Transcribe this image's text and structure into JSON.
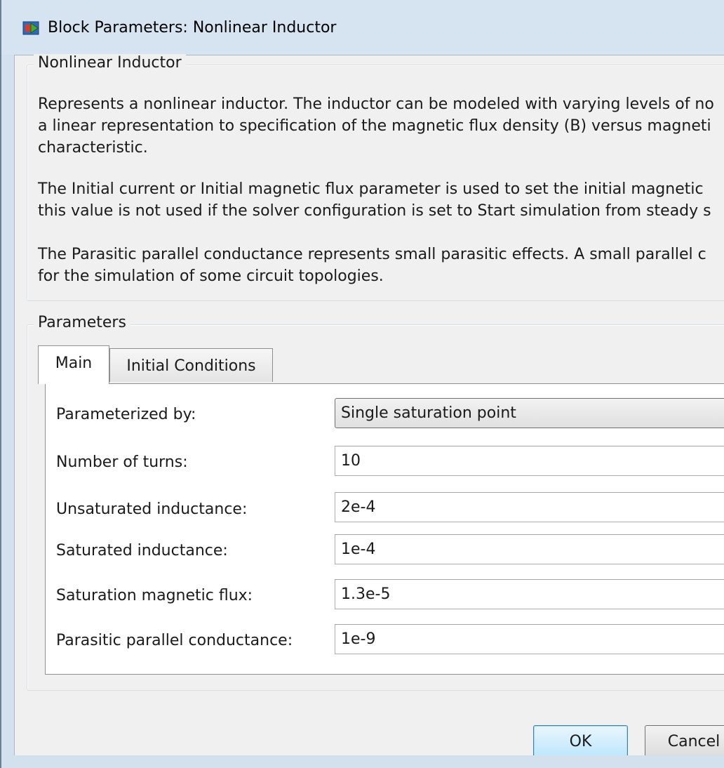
{
  "window": {
    "title": "Block Parameters: Nonlinear Inductor"
  },
  "description_group": {
    "title": "Nonlinear Inductor",
    "paragraphs": [
      [
        "Represents a nonlinear inductor. The inductor can be modeled with varying levels of no",
        "a linear representation to specification of the magnetic flux density (B) versus magneti",
        "characteristic."
      ],
      [
        "The Initial current or Initial magnetic flux parameter is used to set the initial magnetic",
        "this value is not used if the solver configuration is set to Start simulation from steady s"
      ],
      [
        "The Parasitic parallel conductance represents small parasitic effects. A small parallel c",
        "for the simulation of some circuit topologies."
      ]
    ]
  },
  "parameters_group": {
    "title": "Parameters",
    "tabs": [
      {
        "label": "Main",
        "selected": true
      },
      {
        "label": "Initial Conditions",
        "selected": false
      }
    ],
    "fields": [
      {
        "label": "Parameterized by:",
        "value": "Single saturation point",
        "type": "select"
      },
      {
        "label": "Number of turns:",
        "value": "10",
        "type": "text"
      },
      {
        "label": "Unsaturated inductance:",
        "value": "2e-4",
        "type": "text"
      },
      {
        "label": "Saturated inductance:",
        "value": "1e-4",
        "type": "text"
      },
      {
        "label": "Saturation magnetic flux:",
        "value": "1.3e-5",
        "type": "text"
      },
      {
        "label": "Parasitic parallel conductance:",
        "value": "1e-9",
        "type": "text"
      }
    ]
  },
  "buttons": {
    "ok": "OK",
    "cancel": "Cancel"
  },
  "colors": {
    "frame": "#d3e1ef",
    "client_background": "#f0f0f0",
    "ok_button_border": "#3c7fb1"
  },
  "icons": {
    "app": "simulink-block-icon"
  }
}
